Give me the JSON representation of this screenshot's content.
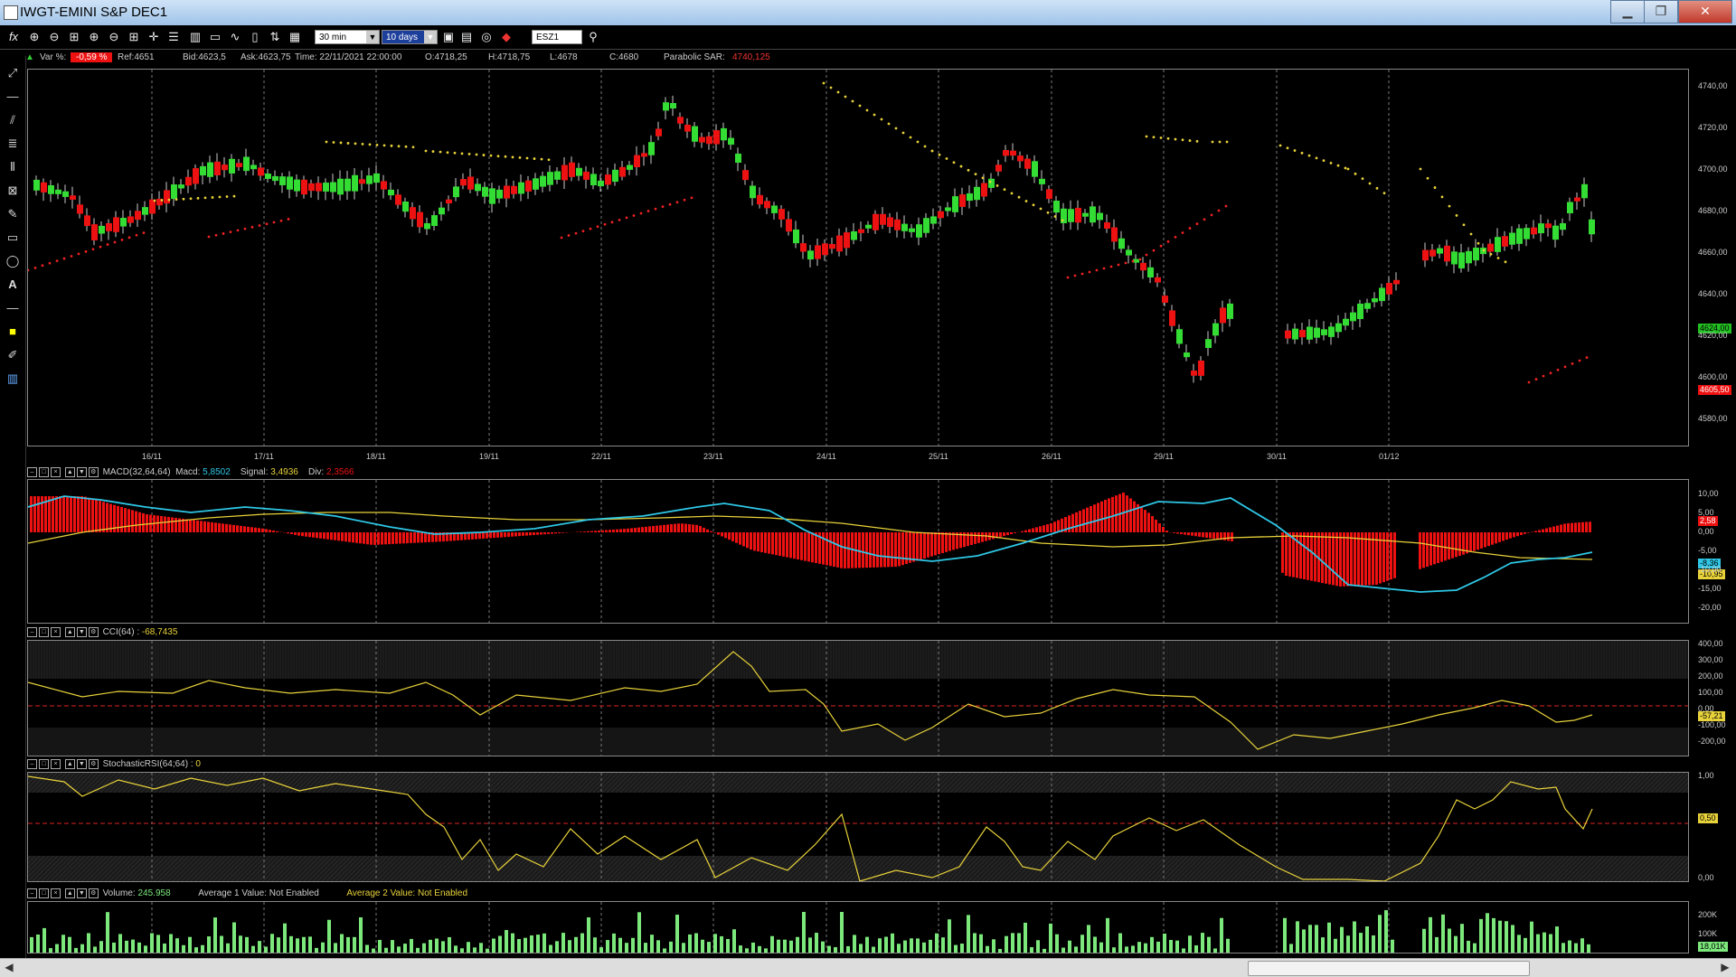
{
  "window": {
    "title": "IWGT-EMINI S&P DEC1",
    "min": "▁",
    "max": "❐",
    "close": "✕"
  },
  "toolbar": {
    "timeframe": "30 min",
    "range": "10 days",
    "symbol": "ESZ1"
  },
  "info": {
    "var_label": "Var %:",
    "var_value": "-0,59 %",
    "ref": "Ref:4651",
    "bid": "Bid:4623,5",
    "ask": "Ask:4623,75",
    "time": "Time: 22/11/2021 22:00:00",
    "open": "O:4718,25",
    "high": "H:4718,75",
    "low": "L:4678",
    "close": "C:4680",
    "sar_label": "Parabolic SAR:",
    "sar_value": "4740,125"
  },
  "price_axis": [
    "4740,00",
    "4720,00",
    "4700,00",
    "4680,00",
    "4660,00",
    "4640,00",
    "4620,00",
    "4600,00",
    "4580,00"
  ],
  "price_tags": {
    "last": "4624,00",
    "sar": "4605,50"
  },
  "date_axis": [
    "16/11",
    "17/11",
    "18/11",
    "19/11",
    "22/11",
    "23/11",
    "24/11",
    "25/11",
    "26/11",
    "29/11",
    "30/11",
    "01/12"
  ],
  "macd": {
    "title": "MACD(32,64,64)",
    "macd_label": "Macd:",
    "macd_value": "5,8502",
    "signal_label": "Signal:",
    "signal_value": "3,4936",
    "div_label": "Div:",
    "div_value": "2,3566",
    "axis": [
      "10,00",
      "5,00",
      "0,00",
      "-5,00",
      "-10,00",
      "-15,00",
      "-20,00"
    ],
    "tag_a": "2,58",
    "tag_b": "-8,36",
    "tag_c": "-10,95"
  },
  "cci": {
    "title": "CCI(64) :",
    "value": "-68,7435",
    "axis": [
      "400,00",
      "300,00",
      "200,00",
      "100,00",
      "0,00",
      "-100,00",
      "-200,00"
    ],
    "tag": "-57,21"
  },
  "stoch": {
    "title": "StochasticRSI(64;64) :",
    "value": "0",
    "axis": [
      "1,00",
      "0,00"
    ],
    "tag": "0,50"
  },
  "volume": {
    "title": "Volume:",
    "value": "245.958",
    "avg1_label": "Average 1 Value:",
    "avg1_value": "Not Enabled",
    "avg2_label": "Average 2 Value:",
    "avg2_value": "Not Enabled",
    "axis": [
      "200K",
      "100K"
    ],
    "tag": "18,01K"
  },
  "colors": {
    "up": "#33dd33",
    "down": "#ee1111",
    "signal": "#e8d23a",
    "macd": "#2ec7e6",
    "bg": "#000000",
    "grid": "#ffffff"
  }
}
